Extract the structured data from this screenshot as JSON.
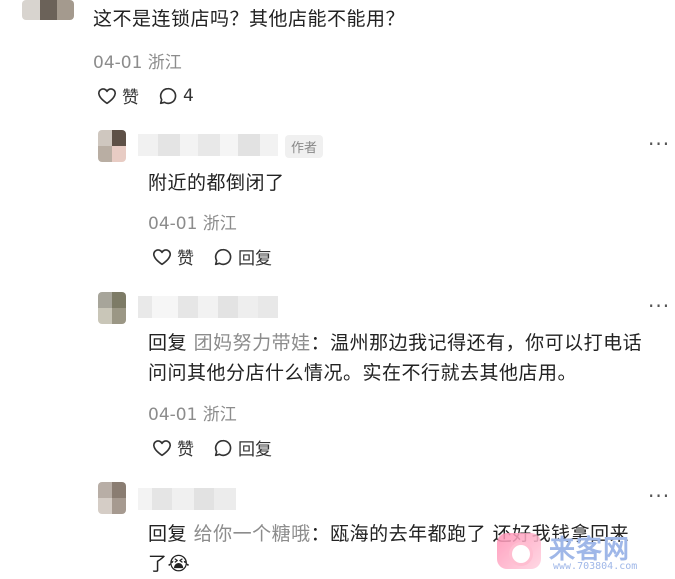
{
  "comments": [
    {
      "text": "这不是连锁店吗？其他店能不能用？",
      "meta": "04-01 浙江",
      "like_label": "赞",
      "comment_count": "4"
    },
    {
      "author_tag": "作者",
      "text": "附近的都倒闭了",
      "meta": "04-01 浙江",
      "like_label": "赞",
      "reply_label": "回复"
    },
    {
      "reply_kw": "回复",
      "reply_to": "团妈努力带娃",
      "separator": "：",
      "text_line1": "温州那边我记得还有，你可以打电话",
      "text_line2": "问问其他分店什么情况。实在不行就去其他店用。",
      "meta": "04-01 浙江",
      "like_label": "赞",
      "reply_label": "回复"
    },
    {
      "reply_kw": "回复",
      "reply_to": "给你一个糖哦",
      "separator": "：",
      "text_line1": "瓯海的去年都跑了 还好我钱拿回来",
      "text_line2": "了",
      "emoji": "😭"
    }
  ],
  "more_label": "···",
  "watermark": {
    "text": "来客网",
    "url": "www.703804.com"
  }
}
